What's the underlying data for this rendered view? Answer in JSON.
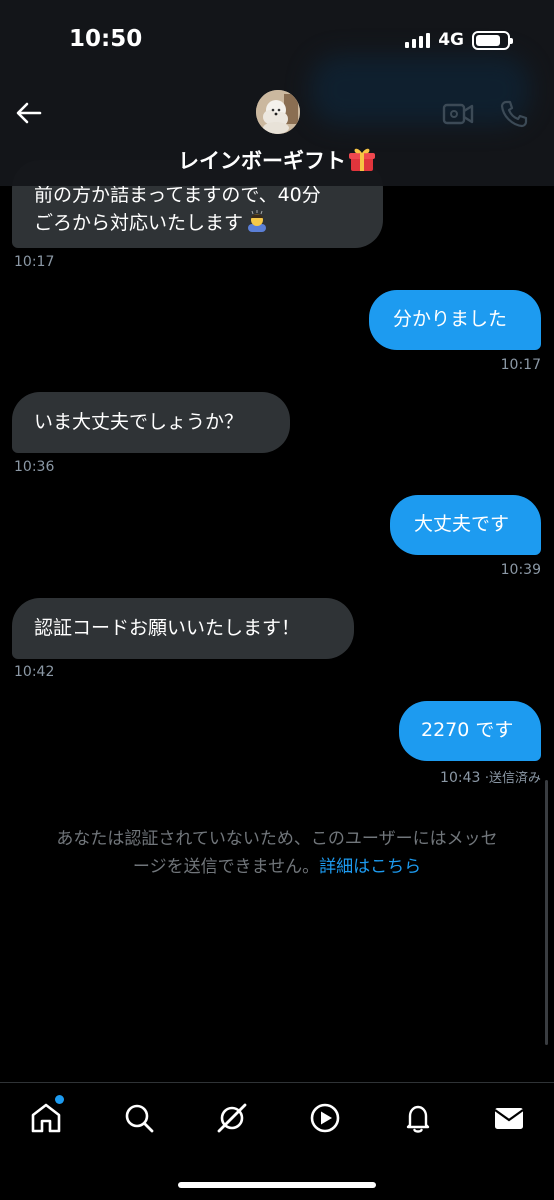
{
  "status_bar": {
    "time": "10:50",
    "network": "4G"
  },
  "header": {
    "contact_name": "レインボーギフト"
  },
  "messages": [
    {
      "direction": "in",
      "lines": [
        "前の方か詰まってますので、40分",
        "ごろから対応いたします"
      ],
      "time": "10:17"
    },
    {
      "direction": "out",
      "text": "分かりました",
      "time": "10:17"
    },
    {
      "direction": "in",
      "text": "いま大丈夫でしょうか？",
      "time": "10:36"
    },
    {
      "direction": "out",
      "text": "大丈夫です",
      "time": "10:39"
    },
    {
      "direction": "in",
      "text": "認証コードお願いいたします！",
      "time": "10:42"
    },
    {
      "direction": "out",
      "text": "2270 です",
      "time": "10:43",
      "status": "送信済み"
    }
  ],
  "notice": {
    "line1": "あなたは認証されていないため、このユーザーにはメッセ",
    "line2": "ージを送信できません。",
    "link": "詳細はこちら"
  },
  "nav": [
    "home-icon",
    "search-icon",
    "grok-icon",
    "video-icon",
    "bell-icon",
    "mail-icon"
  ],
  "colors": {
    "accent": "#1d9bf0",
    "incoming_bubble": "#2f3336",
    "background": "#000000"
  }
}
